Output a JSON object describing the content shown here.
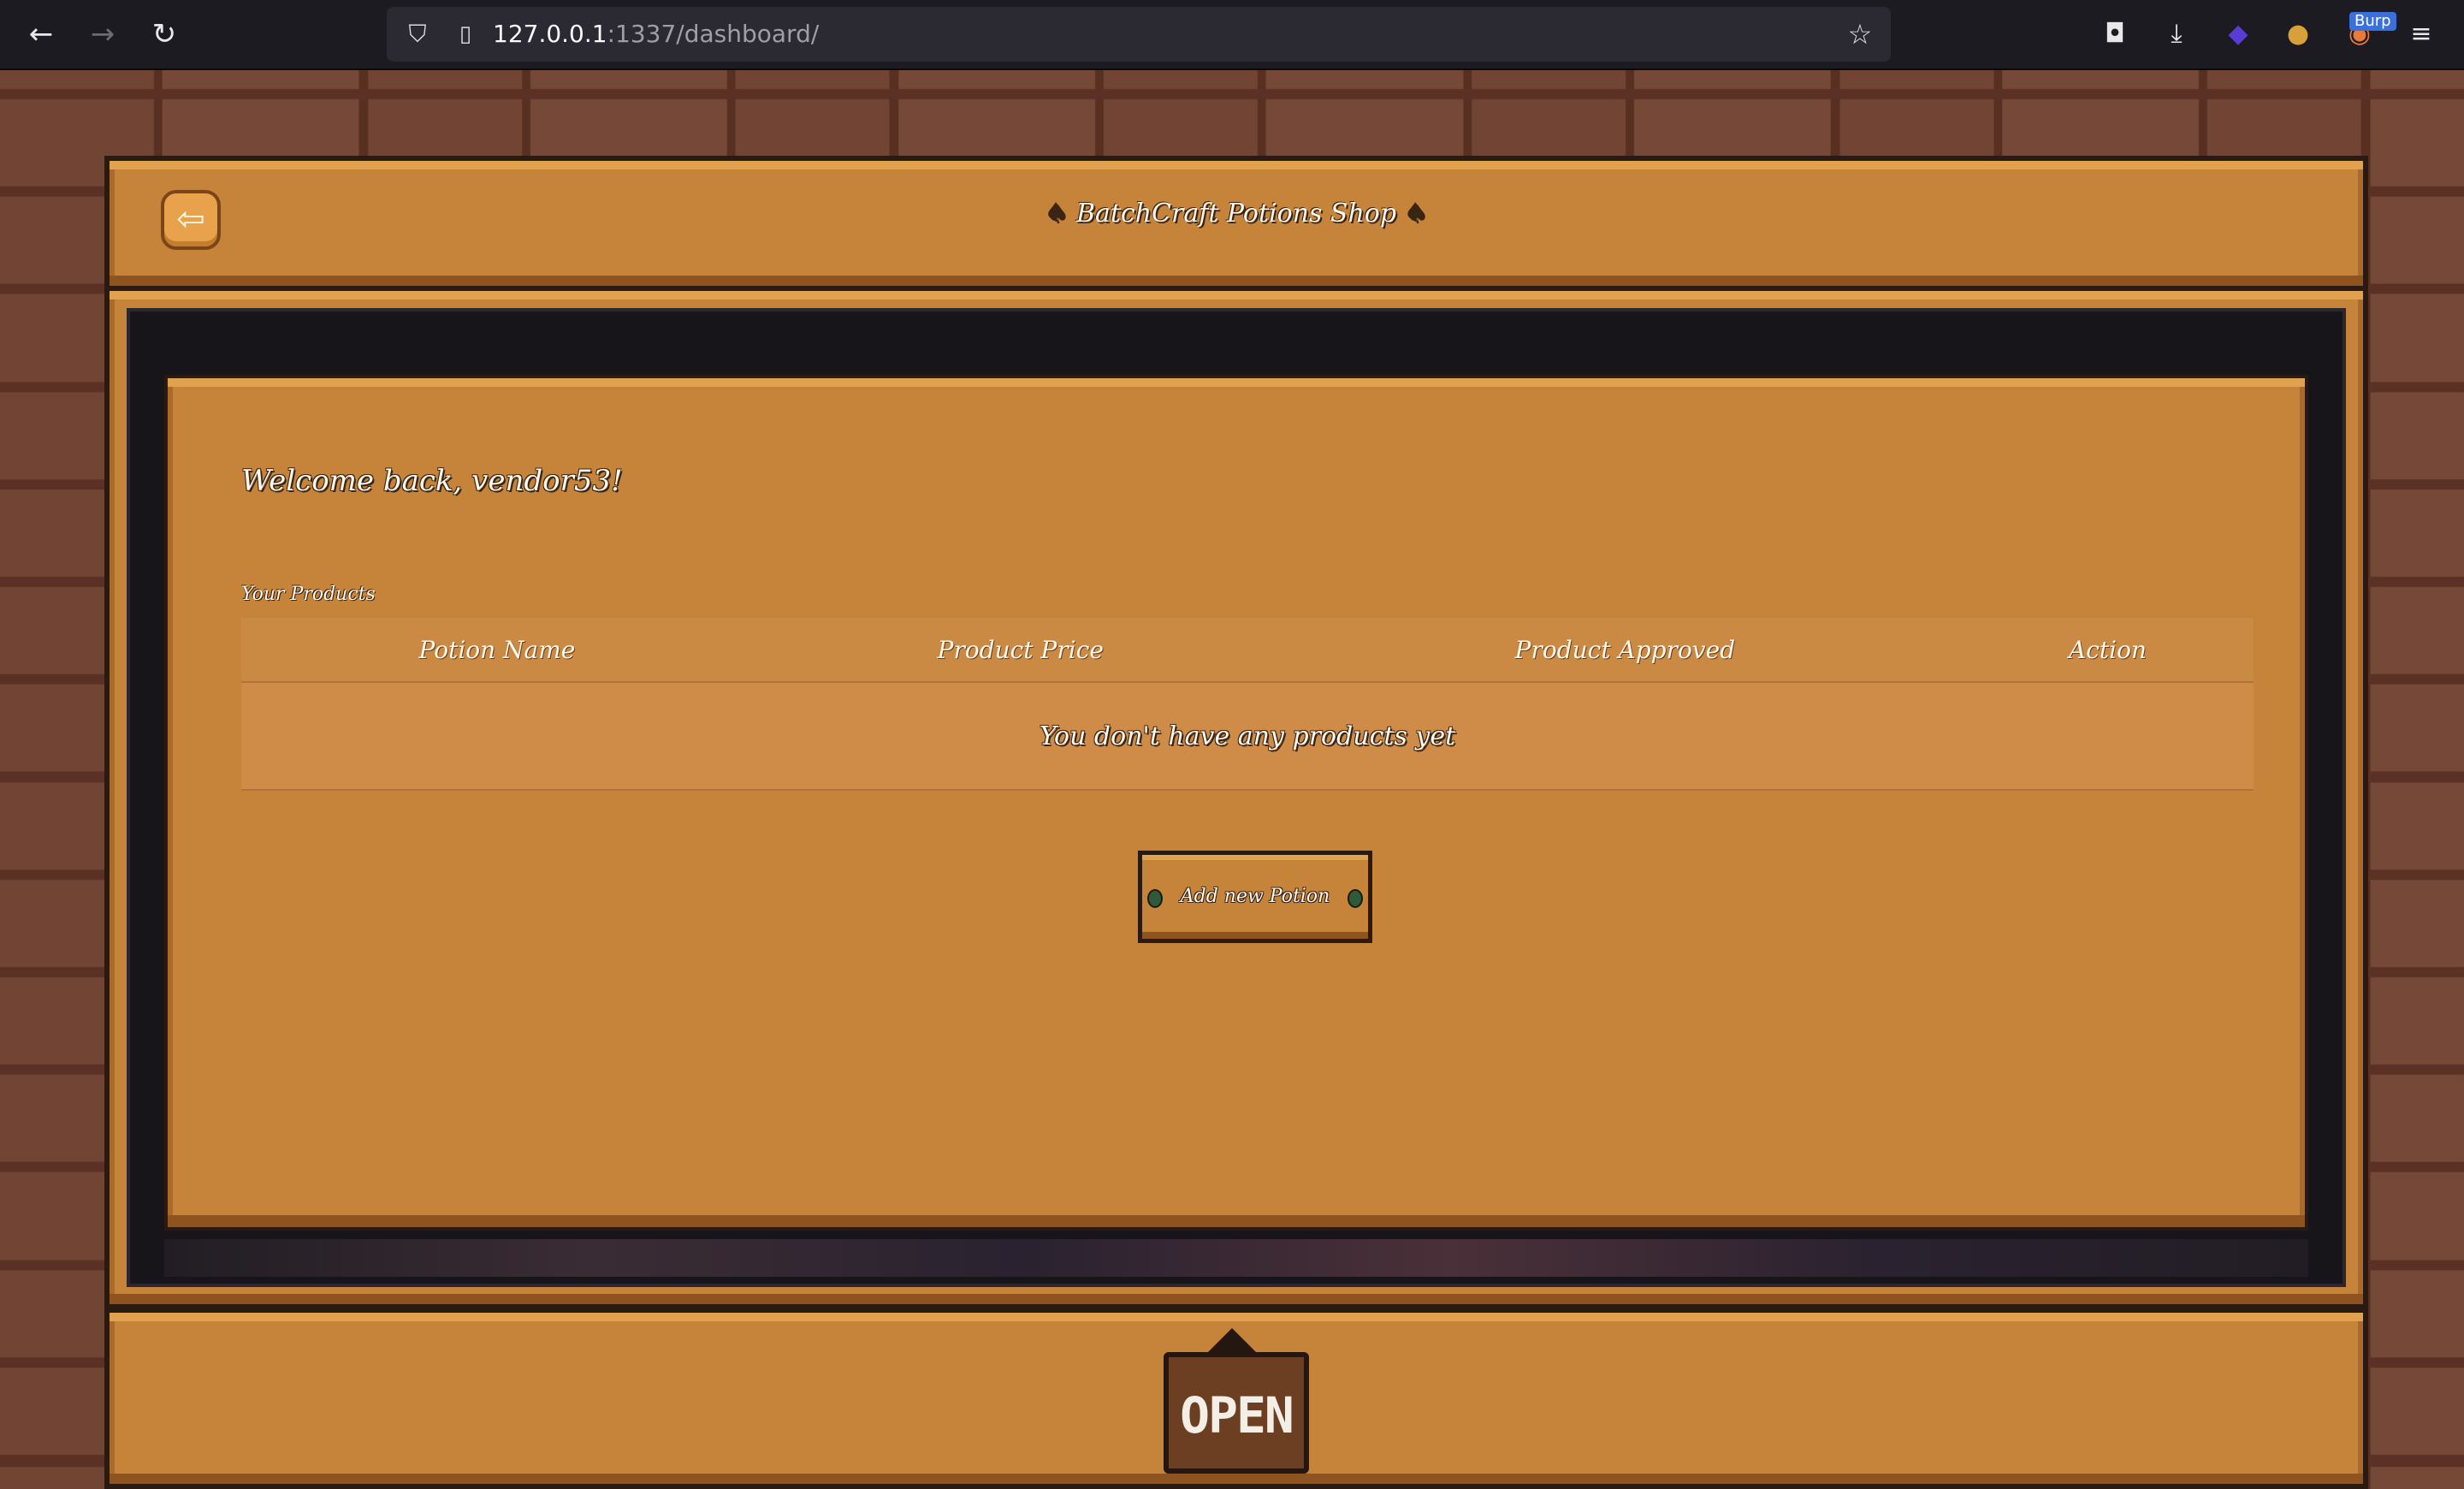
{
  "browser": {
    "url_host": "127.0.0.1",
    "url_rest": ":1337/dashboard/",
    "extension_badge": "Burp"
  },
  "header": {
    "title": "BatchCraft Potions Shop",
    "back_icon": "arrow-left-icon"
  },
  "dashboard": {
    "welcome": "Welcome back, vendor53!",
    "section_label": "Your Products",
    "table": {
      "columns": [
        "Potion Name",
        "Product Price",
        "Product Approved",
        "Action"
      ],
      "rows": [],
      "empty_message": "You don't have any products yet"
    },
    "add_button_label": "Add new Potion"
  },
  "footer": {
    "sign_text": "OPEN"
  },
  "colors": {
    "plank": "#c6833a",
    "plank_highlight": "#e0a24f",
    "frame_dark": "#17141a",
    "text_light": "#fffaf0",
    "outline": "#2a1a12"
  }
}
